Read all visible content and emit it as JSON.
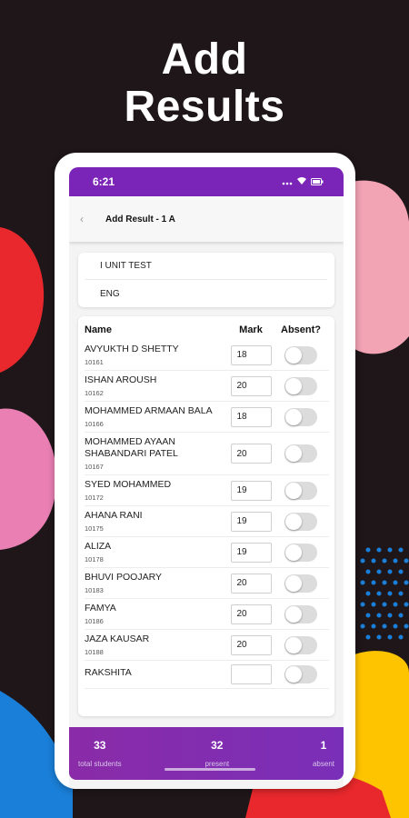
{
  "promo": {
    "line1": "Add",
    "line2": "Results"
  },
  "statusbar": {
    "time": "6:21"
  },
  "appbar": {
    "title": "Add Result - 1 A"
  },
  "exam": {
    "test_name": "I UNIT TEST",
    "subject": "ENG"
  },
  "table": {
    "headers": {
      "name": "Name",
      "mark": "Mark",
      "absent": "Absent?"
    },
    "rows": [
      {
        "name": "AVYUKTH D SHETTY",
        "id": "10161",
        "mark": "18",
        "absent": false
      },
      {
        "name": "ISHAN AROUSH",
        "id": "10162",
        "mark": "20",
        "absent": false
      },
      {
        "name": "MOHAMMED ARMAAN BALA",
        "id": "10166",
        "mark": "18",
        "absent": false
      },
      {
        "name": "MOHAMMED AYAAN SHABANDARI PATEL",
        "id": "10167",
        "mark": "20",
        "absent": false
      },
      {
        "name": "SYED MOHAMMED",
        "id": "10172",
        "mark": "19",
        "absent": false
      },
      {
        "name": "AHANA RANI",
        "id": "10175",
        "mark": "19",
        "absent": false
      },
      {
        "name": "ALIZA",
        "id": "10178",
        "mark": "19",
        "absent": false
      },
      {
        "name": "BHUVI POOJARY",
        "id": "10183",
        "mark": "20",
        "absent": false
      },
      {
        "name": "FAMYA",
        "id": "10186",
        "mark": "20",
        "absent": false
      },
      {
        "name": "JAZA KAUSAR",
        "id": "10188",
        "mark": "20",
        "absent": false
      },
      {
        "name": "RAKSHITA",
        "id": "",
        "mark": "",
        "absent": false
      }
    ]
  },
  "footer": {
    "total": {
      "value": "33",
      "label": "total students"
    },
    "present": {
      "value": "32",
      "label": "present"
    },
    "absent": {
      "value": "1",
      "label": "absent"
    }
  },
  "colors": {
    "accent": "#7a24b8",
    "background": "#1e1619"
  }
}
